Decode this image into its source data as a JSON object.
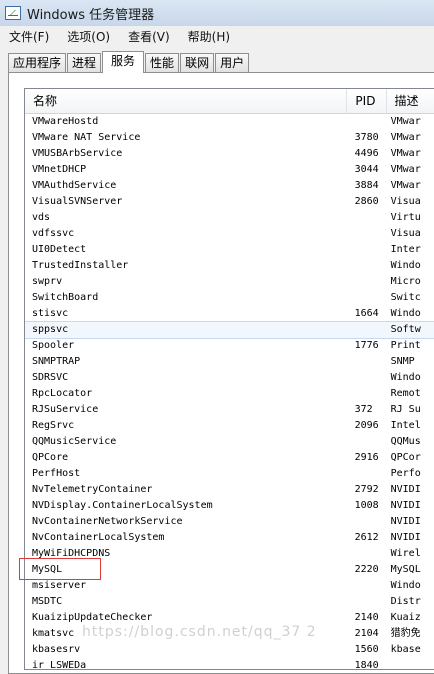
{
  "window": {
    "title": "Windows 任务管理器",
    "icon": "task-manager-icon"
  },
  "menu": {
    "items": [
      "文件(F)",
      "选项(O)",
      "查看(V)",
      "帮助(H)"
    ]
  },
  "tabs": [
    {
      "label": "应用程序",
      "active": false
    },
    {
      "label": "进程",
      "active": false
    },
    {
      "label": "服务",
      "active": true
    },
    {
      "label": "性能",
      "active": false
    },
    {
      "label": "联网",
      "active": false
    },
    {
      "label": "用户",
      "active": false
    }
  ],
  "columns": {
    "name": "名称",
    "pid": "PID",
    "desc": "描述"
  },
  "rows": [
    {
      "name": "VMwareHostd",
      "pid": "",
      "desc": "VMwar"
    },
    {
      "name": "VMware NAT Service",
      "pid": "3780",
      "desc": "VMwar"
    },
    {
      "name": "VMUSBArbService",
      "pid": "4496",
      "desc": "VMwar"
    },
    {
      "name": "VMnetDHCP",
      "pid": "3044",
      "desc": "VMwar"
    },
    {
      "name": "VMAuthdService",
      "pid": "3884",
      "desc": "VMwar"
    },
    {
      "name": "VisualSVNServer",
      "pid": "2860",
      "desc": "Visua"
    },
    {
      "name": "vds",
      "pid": "",
      "desc": "Virtu"
    },
    {
      "name": "vdfssvc",
      "pid": "",
      "desc": "Visua"
    },
    {
      "name": "UI0Detect",
      "pid": "",
      "desc": "Inter"
    },
    {
      "name": "TrustedInstaller",
      "pid": "",
      "desc": "Windo"
    },
    {
      "name": "swprv",
      "pid": "",
      "desc": "Micro"
    },
    {
      "name": "SwitchBoard",
      "pid": "",
      "desc": "Switc"
    },
    {
      "name": "stisvc",
      "pid": "1664",
      "desc": "Windo"
    },
    {
      "name": "sppsvc",
      "pid": "",
      "desc": "Softw",
      "selected": true
    },
    {
      "name": "Spooler",
      "pid": "1776",
      "desc": "Print"
    },
    {
      "name": "SNMPTRAP",
      "pid": "",
      "desc": "SNMP"
    },
    {
      "name": "SDRSVC",
      "pid": "",
      "desc": "Windo"
    },
    {
      "name": "RpcLocator",
      "pid": "",
      "desc": "Remot"
    },
    {
      "name": "RJSuService",
      "pid": "372",
      "desc": "RJ Su"
    },
    {
      "name": "RegSrvc",
      "pid": "2096",
      "desc": "Intel"
    },
    {
      "name": "QQMusicService",
      "pid": "",
      "desc": "QQMus"
    },
    {
      "name": "QPCore",
      "pid": "2916",
      "desc": "QPCor"
    },
    {
      "name": "PerfHost",
      "pid": "",
      "desc": "Perfo"
    },
    {
      "name": "NvTelemetryContainer",
      "pid": "2792",
      "desc": "NVIDI"
    },
    {
      "name": "NVDisplay.ContainerLocalSystem",
      "pid": "1008",
      "desc": "NVIDI"
    },
    {
      "name": "NvContainerNetworkService",
      "pid": "",
      "desc": "NVIDI"
    },
    {
      "name": "NvContainerLocalSystem",
      "pid": "2612",
      "desc": "NVIDI"
    },
    {
      "name": "MyWiFiDHCPDNS",
      "pid": "",
      "desc": "Wirel"
    },
    {
      "name": "MySQL",
      "pid": "2220",
      "desc": "MySQL"
    },
    {
      "name": "msiserver",
      "pid": "",
      "desc": "Windo"
    },
    {
      "name": "MSDTC",
      "pid": "",
      "desc": "Distr"
    },
    {
      "name": "KuaizipUpdateChecker",
      "pid": "2140",
      "desc": "Kuaiz"
    },
    {
      "name": "kmatsvc",
      "pid": "2104",
      "desc": "猎豹免"
    },
    {
      "name": "kbasesrv",
      "pid": "1560",
      "desc": "kbase"
    },
    {
      "name": "ir LSWEDa",
      "pid": "1840",
      "desc": ""
    }
  ],
  "watermark": "https://blog.csdn.net/qq_37 2",
  "colors": {
    "highlight_box": "#e03a3a",
    "selected_row": "#f2f7fd"
  }
}
